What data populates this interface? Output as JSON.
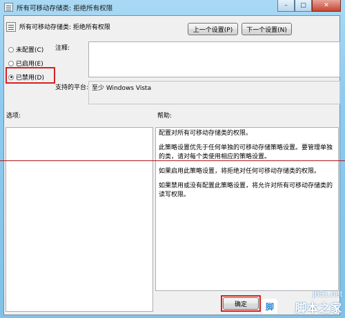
{
  "window": {
    "title": "所有可移动存储类: 拒绝所有权限",
    "controls": {
      "minimize": "–",
      "maximize": "□",
      "close": "✕"
    }
  },
  "header": {
    "title": "所有可移动存储类: 拒绝所有权限",
    "prev_button": "上一个设置(P)",
    "next_button": "下一个设置(N)"
  },
  "radios": [
    {
      "label": "未配置(C)",
      "selected": false
    },
    {
      "label": "已启用(E)",
      "selected": false
    },
    {
      "label": "已禁用(D)",
      "selected": true
    }
  ],
  "comment": {
    "label": "注释:",
    "value": ""
  },
  "platform": {
    "label": "支持的平台:",
    "value": "至少 Windows Vista"
  },
  "options": {
    "label": "选项:"
  },
  "help": {
    "label": "帮助:",
    "paragraphs": [
      "配置对所有可移动存储类的权限。",
      "此策略设置优先于任何单独的可移动存储策略设置。要管理单独的类，请对每个类使用相应的策略设置。",
      "如果启用此策略设置，将拒绝对任何可移动存储类的权限。",
      "如果禁用或没有配置此策略设置，将允许对所有可移动存储类的读写权限。"
    ]
  },
  "footer": {
    "ok_button": "确定"
  },
  "watermark": {
    "url": "jb51.net",
    "brand": "脚本之家",
    "logo": "脚"
  },
  "colors": {
    "highlight": "#d42020",
    "titlebar": "#8fcbef"
  }
}
